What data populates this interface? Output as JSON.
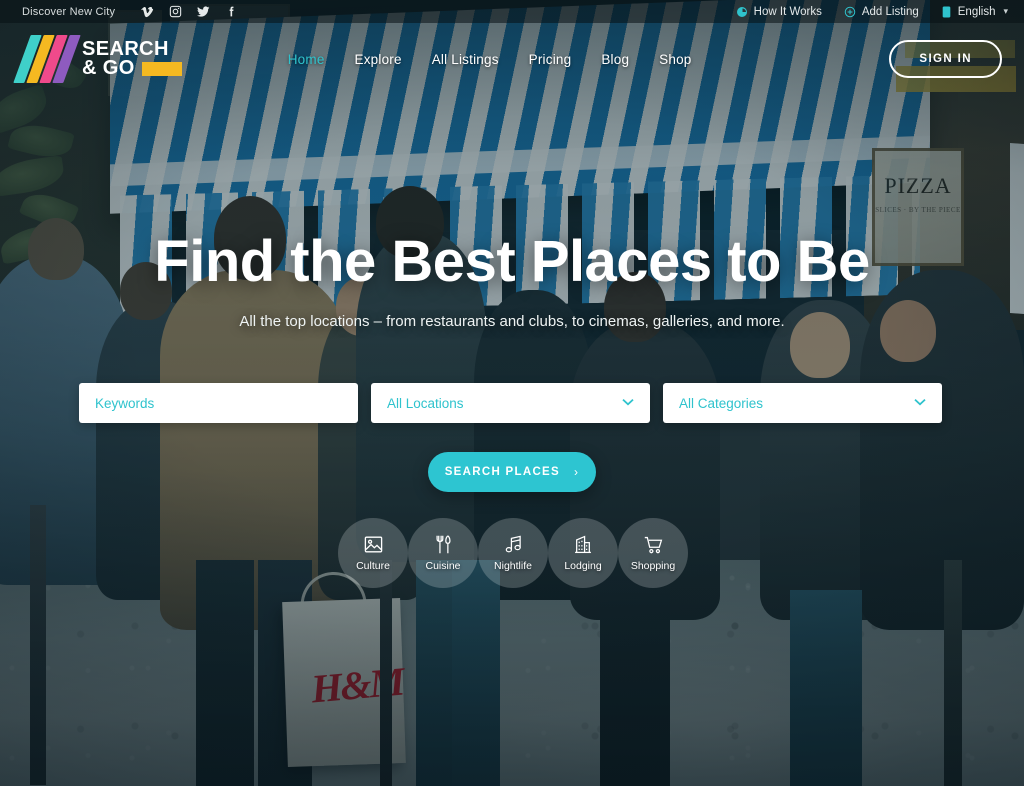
{
  "topbar": {
    "tagline": "Discover New City",
    "social": [
      {
        "name": "vimeo-icon",
        "label": "Vimeo"
      },
      {
        "name": "instagram-icon",
        "label": "Instagram"
      },
      {
        "name": "twitter-icon",
        "label": "Twitter"
      },
      {
        "name": "facebook-icon",
        "label": "Facebook"
      }
    ],
    "how_it_works": "How It Works",
    "add_listing": "Add Listing",
    "language": "English",
    "language_chevron": "▾"
  },
  "header": {
    "logo_line1": "SEARCH",
    "logo_line2": "& GO",
    "logo_colors": [
      "#3fd0c9",
      "#f5b921",
      "#ef4a8b",
      "#8e5bbf"
    ],
    "logo_bar_color": "#f5b921",
    "nav": [
      {
        "label": "Home",
        "active": true
      },
      {
        "label": "Explore",
        "active": false
      },
      {
        "label": "All Listings",
        "active": false
      },
      {
        "label": "Pricing",
        "active": false
      },
      {
        "label": "Blog",
        "active": false
      },
      {
        "label": "Shop",
        "active": false
      }
    ],
    "signin_label": "SIGN IN"
  },
  "hero": {
    "title": "Find the Best Places to Be",
    "subtitle": "All the top locations – from restaurants and clubs, to cinemas, galleries, and more.",
    "search": {
      "keywords_placeholder": "Keywords",
      "keywords_value": "",
      "location_value": "All Locations",
      "category_value": "All Categories",
      "chevron": "⌄",
      "button_label": "SEARCH PLACES",
      "button_arrow": "›"
    },
    "categories": [
      {
        "label": "Culture",
        "icon": "image-icon"
      },
      {
        "label": "Cuisine",
        "icon": "fork-knife-icon"
      },
      {
        "label": "Nightlife",
        "icon": "music-note-icon"
      },
      {
        "label": "Lodging",
        "icon": "building-icon"
      },
      {
        "label": "Shopping",
        "icon": "shopping-cart-icon"
      }
    ]
  },
  "theme": {
    "accent": "#2fc3cd",
    "button": "#2dc5d1",
    "white": "#ffffff"
  },
  "background_photo": {
    "description": "Crowded street scene with blue and white striped awning storefront",
    "signs": {
      "pizza": "PIZZA",
      "pizza_sub": "SLICES · BY THE PIECE",
      "bag_brand": "H&M"
    }
  }
}
